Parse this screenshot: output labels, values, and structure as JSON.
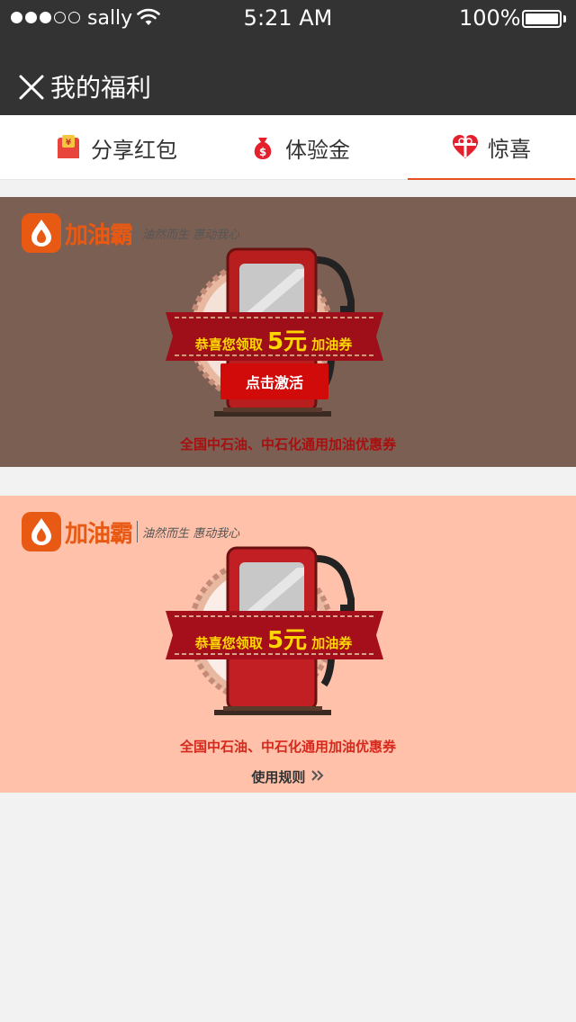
{
  "status_bar": {
    "carrier": "sally",
    "time": "5:21 AM",
    "battery": "100%"
  },
  "nav": {
    "title": "我的福利"
  },
  "tabs": [
    {
      "label": "分享红包",
      "icon": "red-envelope-icon"
    },
    {
      "label": "体验金",
      "icon": "money-bag-icon"
    },
    {
      "label": "惊喜",
      "icon": "gift-heart-icon",
      "active": true
    }
  ],
  "coupons": [
    {
      "brand": "加油霸",
      "slogan": "油然而生 惠动我心",
      "ribbon_prefix": "恭喜您领取",
      "amount": "5元",
      "ribbon_suffix": "加油券",
      "action_label": "点击激活",
      "description": "全国中石油、中石化通用加油优惠券"
    },
    {
      "brand": "加油霸",
      "slogan": "油然而生 惠动我心",
      "ribbon_prefix": "恭喜您领取",
      "amount": "5元",
      "ribbon_suffix": "加油券",
      "description": "全国中石油、中石化通用加油优惠券",
      "rules_label": "使用规则"
    }
  ],
  "colors": {
    "header_bg": "#333333",
    "tab_active_underline": "#e8501f",
    "card1_bg": "#7c5f53",
    "card2_bg": "#ffc1a9",
    "brand_orange": "#e85a14"
  }
}
